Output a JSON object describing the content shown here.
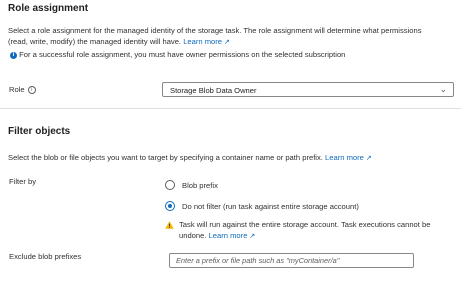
{
  "role_assignment": {
    "heading": "Role assignment",
    "description_line1": "Select a role assignment for the managed identity of the storage task. The role assignment will determine what permissions",
    "description_line2": "(read, write, modify) the managed identity will have.",
    "learn_more": "Learn more",
    "info_icon": "info-icon",
    "notice": "For a successful role assignment, you must have owner permissions on the selected subscription",
    "role_label": "Role",
    "role_value": "Storage Blob Data Owner"
  },
  "filter_objects": {
    "heading": "Filter objects",
    "description": "Select the blob or file objects you want to target by specifying a container name or path prefix.",
    "learn_more": "Learn more",
    "filter_by_label": "Filter by",
    "options": [
      {
        "label": "Blob prefix",
        "selected": false
      },
      {
        "label": "Do not filter (run task against entire storage account)",
        "selected": true
      }
    ],
    "warning_line1": "Task will run against the entire storage account. Task executions cannot be",
    "warning_line2": "undone.",
    "warning_learn_more": "Learn more",
    "exclude_label": "Exclude blob prefixes",
    "exclude_placeholder": "Enter a prefix or file path such as \"myContainer/a\""
  },
  "colors": {
    "accent": "#0f6cbd",
    "warning": "#f7b900"
  }
}
